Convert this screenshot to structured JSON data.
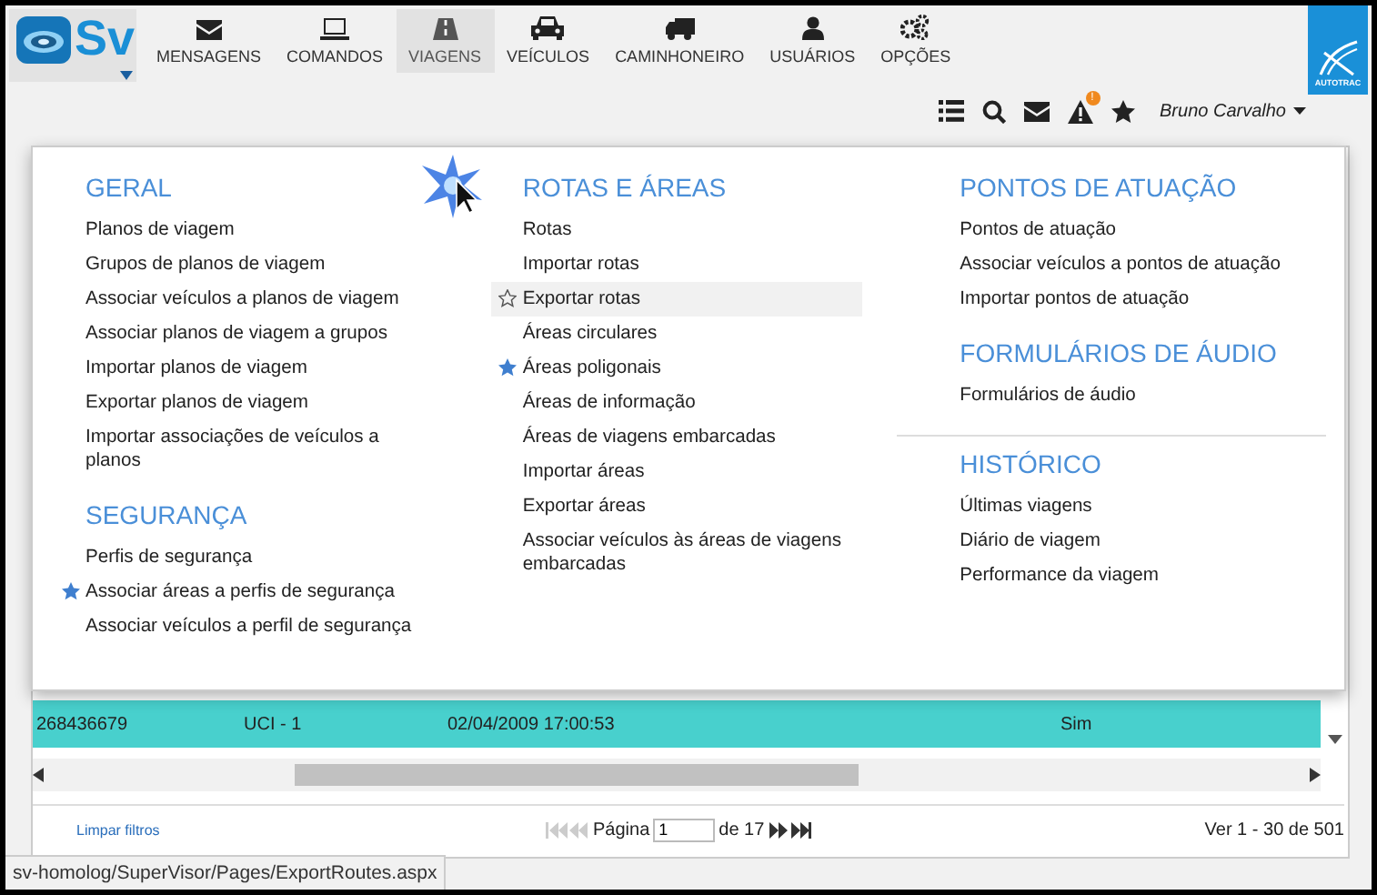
{
  "logo": {
    "text": "Sv"
  },
  "nav": [
    {
      "label": "MENSAGENS",
      "selected": false
    },
    {
      "label": "COMANDOS",
      "selected": false
    },
    {
      "label": "VIAGENS",
      "selected": true
    },
    {
      "label": "VEÍCULOS",
      "selected": false
    },
    {
      "label": "CAMINHONEIRO",
      "selected": false
    },
    {
      "label": "USUÁRIOS",
      "selected": false
    },
    {
      "label": "OPÇÕES",
      "selected": false
    }
  ],
  "brand": {
    "text": "AUTOTRAC"
  },
  "toolbar": {
    "alert_badge": "!",
    "user": "Bruno Carvalho"
  },
  "menu": {
    "columns": [
      [
        {
          "title": "GERAL",
          "items": [
            {
              "label": "Planos de viagem",
              "favorite": false,
              "hovered": false
            },
            {
              "label": "Grupos de planos de viagem",
              "favorite": false,
              "hovered": false
            },
            {
              "label": "Associar veículos a planos de viagem",
              "favorite": false,
              "hovered": false
            },
            {
              "label": "Associar planos de viagem a grupos",
              "favorite": false,
              "hovered": false
            },
            {
              "label": "Importar planos de viagem",
              "favorite": false,
              "hovered": false
            },
            {
              "label": "Exportar planos de viagem",
              "favorite": false,
              "hovered": false
            },
            {
              "label": "Importar associações de veículos a planos",
              "favorite": false,
              "hovered": false
            }
          ]
        },
        {
          "title": "SEGURANÇA",
          "items": [
            {
              "label": "Perfis de segurança",
              "favorite": false,
              "hovered": false
            },
            {
              "label": "Associar áreas a perfis de segurança",
              "favorite": true,
              "hovered": false
            },
            {
              "label": "Associar veículos a perfil de segurança",
              "favorite": false,
              "hovered": false
            }
          ]
        }
      ],
      [
        {
          "title": "ROTAS E ÁREAS",
          "items": [
            {
              "label": "Rotas",
              "favorite": false,
              "hovered": false
            },
            {
              "label": "Importar rotas",
              "favorite": false,
              "hovered": false
            },
            {
              "label": "Exportar rotas",
              "favorite": false,
              "hovered": true
            },
            {
              "label": "Áreas circulares",
              "favorite": false,
              "hovered": false
            },
            {
              "label": "Áreas poligonais",
              "favorite": true,
              "hovered": false
            },
            {
              "label": "Áreas de informação",
              "favorite": false,
              "hovered": false
            },
            {
              "label": "Áreas de viagens embarcadas",
              "favorite": false,
              "hovered": false
            },
            {
              "label": "Importar áreas",
              "favorite": false,
              "hovered": false
            },
            {
              "label": "Exportar áreas",
              "favorite": false,
              "hovered": false
            },
            {
              "label": "Associar veículos às áreas de viagens embarcadas",
              "favorite": false,
              "hovered": false
            }
          ]
        }
      ],
      [
        {
          "title": "PONTOS DE ATUAÇÃO",
          "items": [
            {
              "label": "Pontos de atuação",
              "favorite": false,
              "hovered": false
            },
            {
              "label": "Associar veículos a pontos de atuação",
              "favorite": false,
              "hovered": false
            },
            {
              "label": "Importar pontos de atuação",
              "favorite": false,
              "hovered": false
            }
          ]
        },
        {
          "title": "FORMULÁRIOS DE ÁUDIO",
          "items": [
            {
              "label": "Formulários de áudio",
              "favorite": false,
              "hovered": false
            }
          ]
        },
        {
          "title": "HISTÓRICO",
          "divider": true,
          "items": [
            {
              "label": "Últimas viagens",
              "favorite": false,
              "hovered": false
            },
            {
              "label": "Diário de viagem",
              "favorite": false,
              "hovered": false
            },
            {
              "label": "Performance da viagem",
              "favorite": false,
              "hovered": false
            }
          ]
        }
      ]
    ]
  },
  "table": {
    "rows": [
      {
        "cells": [
          "268436679",
          "UCI - 1",
          "02/04/2009 17:00:53",
          "Sim"
        ],
        "selected": true
      }
    ]
  },
  "footer": {
    "clear_filters": "Limpar filtros",
    "page_label": "Página",
    "page": "1",
    "page_total": "de 17",
    "range": "Ver 1 - 30 de 501"
  },
  "status_bar": {
    "url": "sv-homolog/SuperVisor/Pages/ExportRoutes.aspx"
  }
}
